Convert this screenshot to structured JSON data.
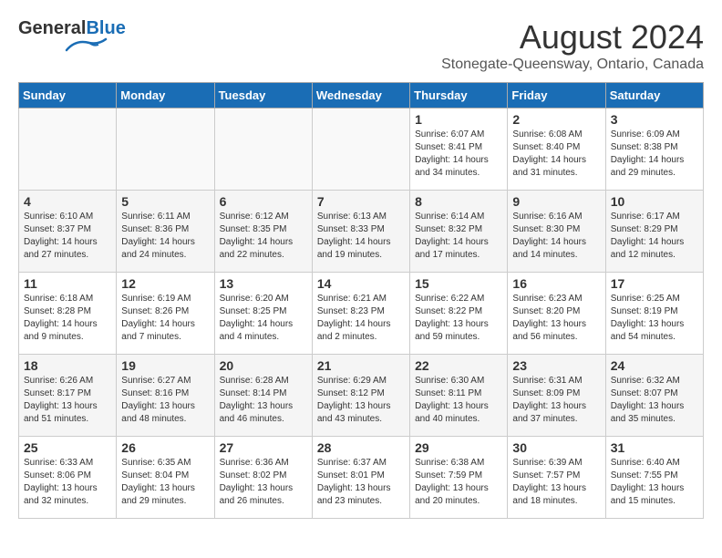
{
  "header": {
    "logo_general": "General",
    "logo_blue": "Blue",
    "month_title": "August 2024",
    "location": "Stonegate-Queensway, Ontario, Canada"
  },
  "days_of_week": [
    "Sunday",
    "Monday",
    "Tuesday",
    "Wednesday",
    "Thursday",
    "Friday",
    "Saturday"
  ],
  "weeks": [
    [
      {
        "day": "",
        "info": ""
      },
      {
        "day": "",
        "info": ""
      },
      {
        "day": "",
        "info": ""
      },
      {
        "day": "",
        "info": ""
      },
      {
        "day": "1",
        "info": "Sunrise: 6:07 AM\nSunset: 8:41 PM\nDaylight: 14 hours\nand 34 minutes."
      },
      {
        "day": "2",
        "info": "Sunrise: 6:08 AM\nSunset: 8:40 PM\nDaylight: 14 hours\nand 31 minutes."
      },
      {
        "day": "3",
        "info": "Sunrise: 6:09 AM\nSunset: 8:38 PM\nDaylight: 14 hours\nand 29 minutes."
      }
    ],
    [
      {
        "day": "4",
        "info": "Sunrise: 6:10 AM\nSunset: 8:37 PM\nDaylight: 14 hours\nand 27 minutes."
      },
      {
        "day": "5",
        "info": "Sunrise: 6:11 AM\nSunset: 8:36 PM\nDaylight: 14 hours\nand 24 minutes."
      },
      {
        "day": "6",
        "info": "Sunrise: 6:12 AM\nSunset: 8:35 PM\nDaylight: 14 hours\nand 22 minutes."
      },
      {
        "day": "7",
        "info": "Sunrise: 6:13 AM\nSunset: 8:33 PM\nDaylight: 14 hours\nand 19 minutes."
      },
      {
        "day": "8",
        "info": "Sunrise: 6:14 AM\nSunset: 8:32 PM\nDaylight: 14 hours\nand 17 minutes."
      },
      {
        "day": "9",
        "info": "Sunrise: 6:16 AM\nSunset: 8:30 PM\nDaylight: 14 hours\nand 14 minutes."
      },
      {
        "day": "10",
        "info": "Sunrise: 6:17 AM\nSunset: 8:29 PM\nDaylight: 14 hours\nand 12 minutes."
      }
    ],
    [
      {
        "day": "11",
        "info": "Sunrise: 6:18 AM\nSunset: 8:28 PM\nDaylight: 14 hours\nand 9 minutes."
      },
      {
        "day": "12",
        "info": "Sunrise: 6:19 AM\nSunset: 8:26 PM\nDaylight: 14 hours\nand 7 minutes."
      },
      {
        "day": "13",
        "info": "Sunrise: 6:20 AM\nSunset: 8:25 PM\nDaylight: 14 hours\nand 4 minutes."
      },
      {
        "day": "14",
        "info": "Sunrise: 6:21 AM\nSunset: 8:23 PM\nDaylight: 14 hours\nand 2 minutes."
      },
      {
        "day": "15",
        "info": "Sunrise: 6:22 AM\nSunset: 8:22 PM\nDaylight: 13 hours\nand 59 minutes."
      },
      {
        "day": "16",
        "info": "Sunrise: 6:23 AM\nSunset: 8:20 PM\nDaylight: 13 hours\nand 56 minutes."
      },
      {
        "day": "17",
        "info": "Sunrise: 6:25 AM\nSunset: 8:19 PM\nDaylight: 13 hours\nand 54 minutes."
      }
    ],
    [
      {
        "day": "18",
        "info": "Sunrise: 6:26 AM\nSunset: 8:17 PM\nDaylight: 13 hours\nand 51 minutes."
      },
      {
        "day": "19",
        "info": "Sunrise: 6:27 AM\nSunset: 8:16 PM\nDaylight: 13 hours\nand 48 minutes."
      },
      {
        "day": "20",
        "info": "Sunrise: 6:28 AM\nSunset: 8:14 PM\nDaylight: 13 hours\nand 46 minutes."
      },
      {
        "day": "21",
        "info": "Sunrise: 6:29 AM\nSunset: 8:12 PM\nDaylight: 13 hours\nand 43 minutes."
      },
      {
        "day": "22",
        "info": "Sunrise: 6:30 AM\nSunset: 8:11 PM\nDaylight: 13 hours\nand 40 minutes."
      },
      {
        "day": "23",
        "info": "Sunrise: 6:31 AM\nSunset: 8:09 PM\nDaylight: 13 hours\nand 37 minutes."
      },
      {
        "day": "24",
        "info": "Sunrise: 6:32 AM\nSunset: 8:07 PM\nDaylight: 13 hours\nand 35 minutes."
      }
    ],
    [
      {
        "day": "25",
        "info": "Sunrise: 6:33 AM\nSunset: 8:06 PM\nDaylight: 13 hours\nand 32 minutes."
      },
      {
        "day": "26",
        "info": "Sunrise: 6:35 AM\nSunset: 8:04 PM\nDaylight: 13 hours\nand 29 minutes."
      },
      {
        "day": "27",
        "info": "Sunrise: 6:36 AM\nSunset: 8:02 PM\nDaylight: 13 hours\nand 26 minutes."
      },
      {
        "day": "28",
        "info": "Sunrise: 6:37 AM\nSunset: 8:01 PM\nDaylight: 13 hours\nand 23 minutes."
      },
      {
        "day": "29",
        "info": "Sunrise: 6:38 AM\nSunset: 7:59 PM\nDaylight: 13 hours\nand 20 minutes."
      },
      {
        "day": "30",
        "info": "Sunrise: 6:39 AM\nSunset: 7:57 PM\nDaylight: 13 hours\nand 18 minutes."
      },
      {
        "day": "31",
        "info": "Sunrise: 6:40 AM\nSunset: 7:55 PM\nDaylight: 13 hours\nand 15 minutes."
      }
    ]
  ]
}
